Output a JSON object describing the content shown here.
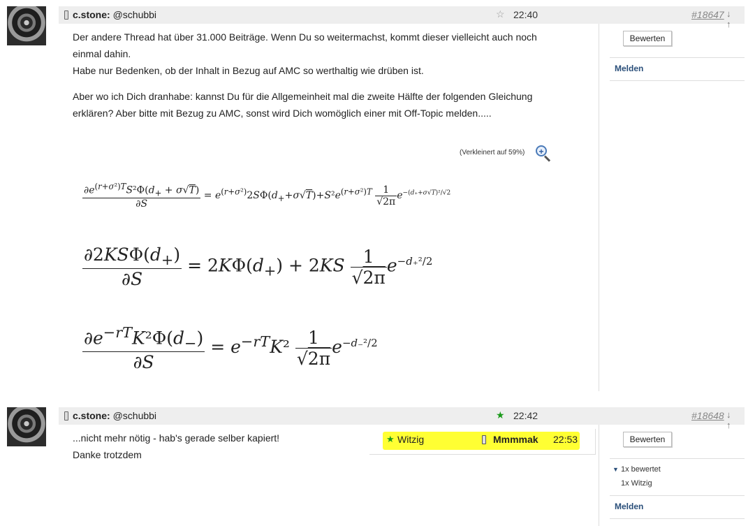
{
  "posts": [
    {
      "username": "c.stone:",
      "handle": "@schubbi",
      "star": "☆",
      "time": "22:40",
      "post_number": "#18647",
      "nav_arrows": "↓ ↑",
      "paragraphs": [
        "Der andere Thread hat über 31.000 Beiträge. Wenn Du so weitermachst, kommt dieser vielleicht auch noch einmal dahin.",
        "Habe nur Bedenken, ob der Inhalt in Bezug auf AMC so werthaltig wie drüben ist.",
        "Aber wo ich Dich dranhabe: kannst Du für die Allgemeinheit mal die zweite Hälfte der folgenden Gleichung erklären? Aber bitte mit Bezug zu AMC, sonst wird Dich womöglich einer mit Off-Topic melden....."
      ],
      "image_caption": "(Verkleinert auf 59%)",
      "rate_button": "Bewerten",
      "report_link": "Melden"
    },
    {
      "username": "c.stone:",
      "handle": "@schubbi",
      "star": "★",
      "time": "22:42",
      "post_number": "#18648",
      "nav_arrows": "↓ ↑",
      "lines": [
        "...nicht mehr nötig - hab's gerade selber kapiert!",
        "Danke trotzdem"
      ],
      "rating": {
        "star": "★",
        "label": "Witzig",
        "user": "Mmmmak",
        "time": "22:53"
      },
      "rate_button": "Bewerten",
      "rated_summary": "1x bewertet",
      "rated_toggle_icon": "▼",
      "rated_detail": "1x Witzig",
      "report_link": "Melden"
    }
  ],
  "colors": {
    "header_bg": "#eeeeee",
    "link": "#2a4f7a",
    "highlight": "#ffff33",
    "star_green": "#1a9a1a",
    "post_number": "#888888"
  },
  "icons": [
    "avatar-gorilla",
    "mobile-device-icon",
    "star-icon",
    "zoom-in-icon"
  ]
}
